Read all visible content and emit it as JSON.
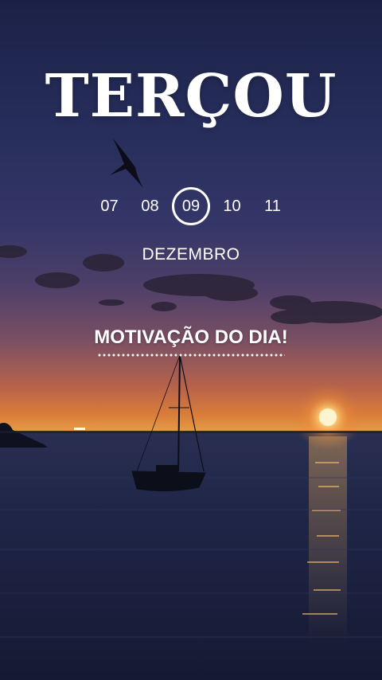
{
  "header": {
    "day_name": "TERÇOU"
  },
  "date_selector": {
    "days": [
      "07",
      "08",
      "09",
      "10",
      "11"
    ],
    "selected": "09",
    "month": "DEZEMBRO"
  },
  "banner": {
    "text": "MOTIVAÇÃO DO DIA!"
  },
  "background": {
    "scene": "sunset over sea with sailboat and seagull",
    "icons": [
      "seagull-silhouette",
      "sailboat-silhouette",
      "sun"
    ],
    "colors": {
      "sky_top": "#1b2146",
      "horizon": "#e49b44",
      "sea": "#1f2647",
      "sun": "#ffe08a"
    }
  }
}
